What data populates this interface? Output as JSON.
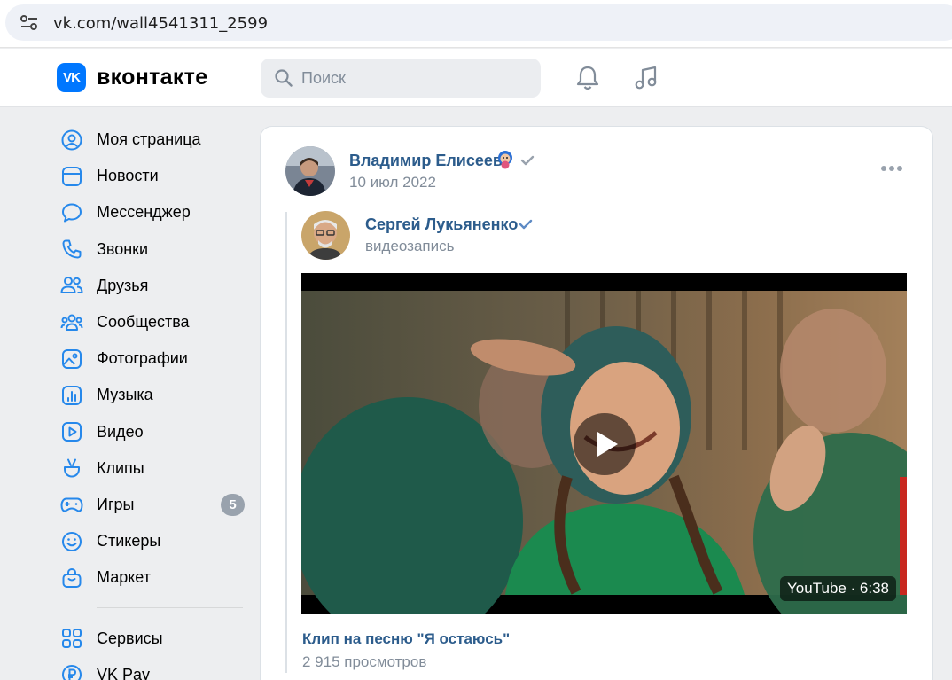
{
  "browser": {
    "url": "vk.com/wall4541311_2599"
  },
  "header": {
    "logo_mark": "VK",
    "logo_text": "вконтакте",
    "search_placeholder": "Поиск",
    "icons": [
      "bell-icon",
      "music-note-icon"
    ]
  },
  "sidebar": {
    "items": [
      {
        "label": "Моя страница",
        "icon": "user-circle-icon"
      },
      {
        "label": "Новости",
        "icon": "news-icon"
      },
      {
        "label": "Мессенджер",
        "icon": "chat-bubble-icon"
      },
      {
        "label": "Звонки",
        "icon": "phone-icon"
      },
      {
        "label": "Друзья",
        "icon": "friends-icon"
      },
      {
        "label": "Сообщества",
        "icon": "communities-icon"
      },
      {
        "label": "Фотографии",
        "icon": "photo-icon"
      },
      {
        "label": "Музыка",
        "icon": "music-icon"
      },
      {
        "label": "Видео",
        "icon": "video-icon"
      },
      {
        "label": "Клипы",
        "icon": "clips-icon"
      },
      {
        "label": "Игры",
        "icon": "gamepad-icon",
        "badge": "5"
      },
      {
        "label": "Стикеры",
        "icon": "smile-icon"
      },
      {
        "label": "Маркет",
        "icon": "bag-icon"
      }
    ],
    "secondary": [
      {
        "label": "Сервисы",
        "icon": "services-icon"
      },
      {
        "label": "VK Pay",
        "icon": "ruble-icon"
      }
    ]
  },
  "post": {
    "author": "Владимир Елисеев",
    "date": "10 июл 2022",
    "repost": {
      "author": "Сергей Лукьяненко",
      "subtitle": "видеозапись"
    },
    "video": {
      "duration": "YouTube · 6:38",
      "title": "Клип на песню \"Я остаюсь\"",
      "views": "2 915 просмотров"
    }
  }
}
